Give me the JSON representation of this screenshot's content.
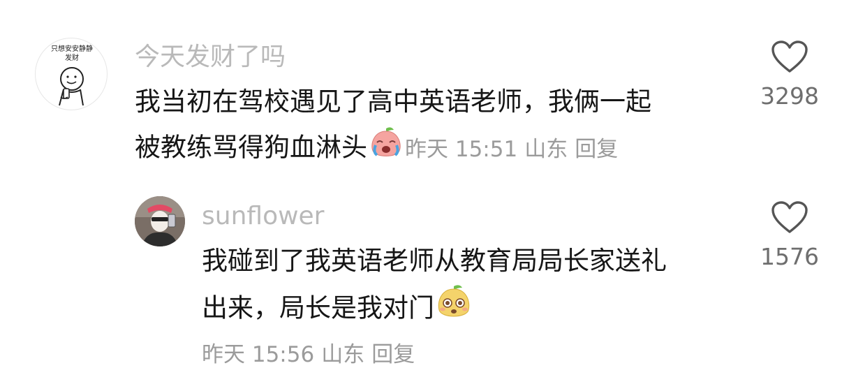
{
  "comments": [
    {
      "avatar_text": "只想安安静静发财",
      "username": "今天发财了吗",
      "content_line1": "我当初在驾校遇见了高中英语老师，我俩一起",
      "content_line2": "被教练骂得狗血淋头",
      "emoji": "crying-peach-emoji",
      "time": "昨天 15:51",
      "location": "山东",
      "reply_label": "回复",
      "likes": "3298"
    },
    {
      "username": "sunflower",
      "content_line1": "我碰到了我英语老师从教育局局长家送礼",
      "content_line2": "出来，局长是我对门",
      "emoji": "surprised-face-emoji",
      "time": "昨天 15:56",
      "location": "山东",
      "reply_label": "回复",
      "likes": "1576"
    }
  ],
  "icons": {
    "like": "heart-outline-icon"
  },
  "colors": {
    "username": "#b9b9b9",
    "content": "#161616",
    "meta": "#9b9b9b",
    "like_count": "#6e6e6e",
    "heart_stroke": "#555555"
  }
}
